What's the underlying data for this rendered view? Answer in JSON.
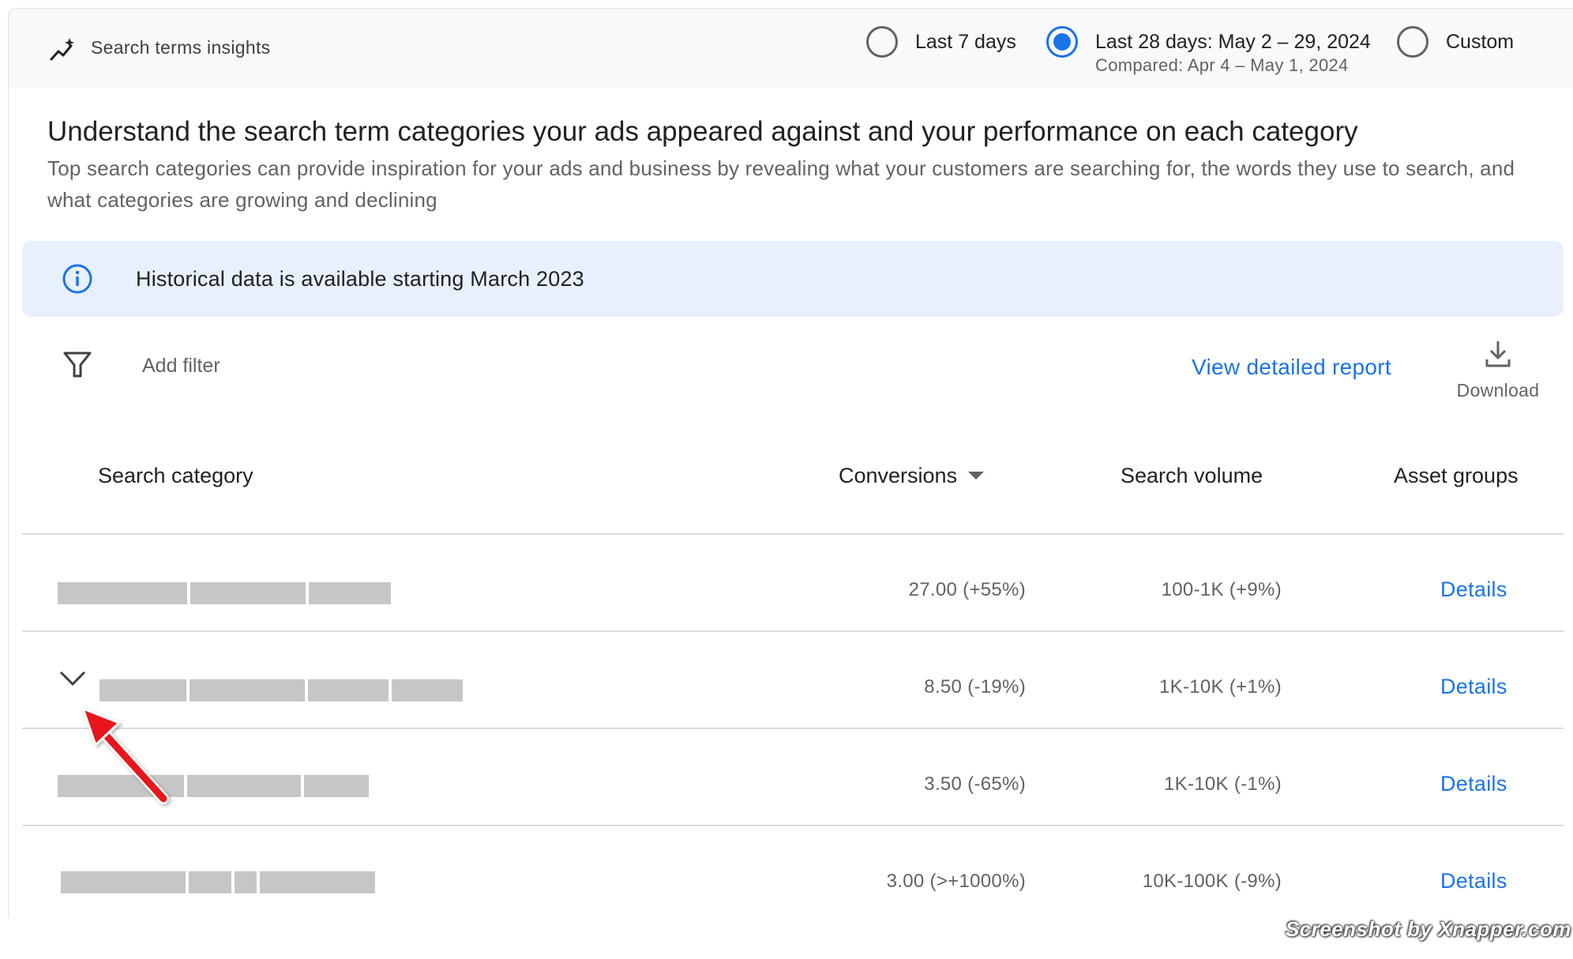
{
  "header": {
    "title": "Search terms insights",
    "date_options": [
      {
        "label": "Last 7 days",
        "checked": false
      },
      {
        "label": "Last 28 days: May 2 – 29, 2024",
        "sublabel": "Compared: Apr 4 – May 1, 2024",
        "checked": true
      },
      {
        "label": "Custom",
        "checked": false
      }
    ]
  },
  "intro": {
    "heading": "Understand the search term categories your ads appeared against and your performance on each category",
    "subtext": "Top search categories can provide inspiration for your ads and business by revealing what your customers are searching for, the words they use to search, and what categories are growing and declining"
  },
  "banner": {
    "text": "Historical data is available starting March 2023"
  },
  "toolbar": {
    "add_filter": "Add filter",
    "view_report": "View detailed report",
    "download": "Download"
  },
  "table": {
    "columns": {
      "category": "Search category",
      "conversions": "Conversions",
      "volume": "Search volume",
      "asset_groups": "Asset groups"
    },
    "rows": [
      {
        "conversions": "27.00 (+55%)",
        "volume": "100-1K (+9%)",
        "asset_groups": "Details"
      },
      {
        "conversions": "8.50 (-19%)",
        "volume": "1K-10K (+1%)",
        "asset_groups": "Details"
      },
      {
        "conversions": "3.50 (-65%)",
        "volume": "1K-10K (-1%)",
        "asset_groups": "Details"
      },
      {
        "conversions": "3.00 (>+1000%)",
        "volume": "10K-100K (-9%)",
        "asset_groups": "Details"
      }
    ]
  },
  "watermark": "Screenshot by Xnapper.com",
  "colors": {
    "accent": "#1a73e8",
    "banner_bg": "#e8f0fe",
    "header_bg": "#f8f9fa",
    "redaction": "#c6c6c6",
    "annotation_arrow": "#e8141b"
  }
}
